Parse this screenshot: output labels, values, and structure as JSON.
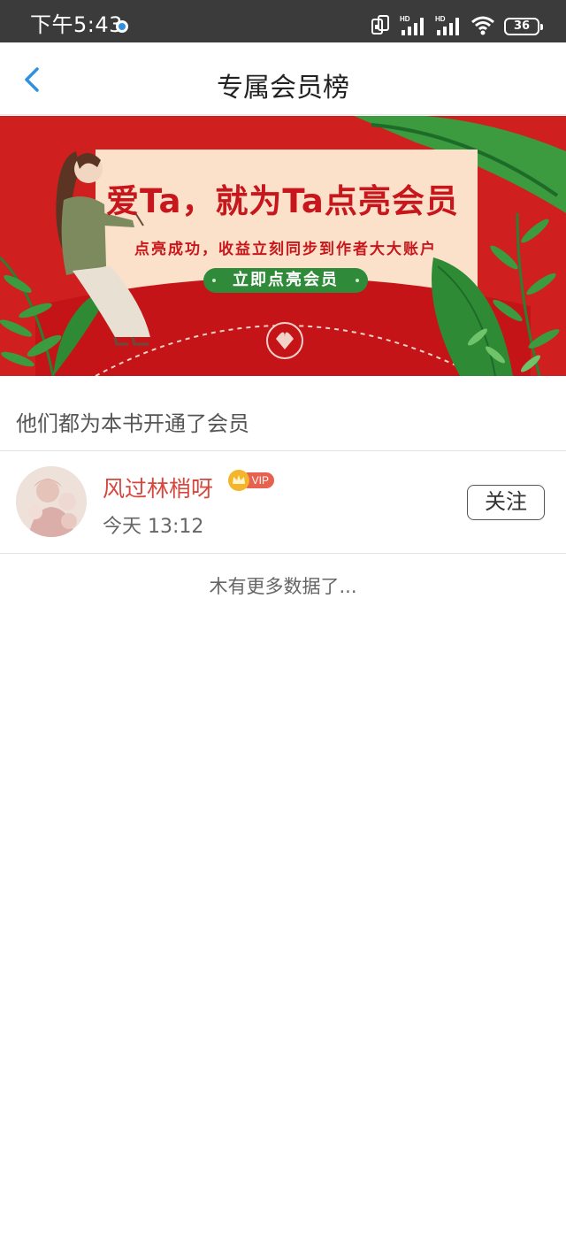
{
  "status_bar": {
    "time": "下午5:43",
    "hd_1": "HD",
    "hd_2": "HD",
    "battery": "36"
  },
  "header": {
    "title": "专属会员榜"
  },
  "banner": {
    "headline": "爱Ta，就为Ta点亮会员",
    "subtitle": "点亮成功，收益立刻同步到作者大大账户",
    "button_label": "立即点亮会员"
  },
  "section": {
    "title": "他们都为本书开通了会员"
  },
  "members": [
    {
      "name": "风过林梢呀",
      "badge": "VIP",
      "time": "今天 13:12",
      "follow_label": "关注"
    }
  ],
  "footer": {
    "no_more": "木有更多数据了..."
  },
  "colors": {
    "banner_red": "#cf1f1f",
    "name_red": "#d6473d",
    "back_blue": "#2f8fe0",
    "button_green": "#2f8a3a"
  }
}
